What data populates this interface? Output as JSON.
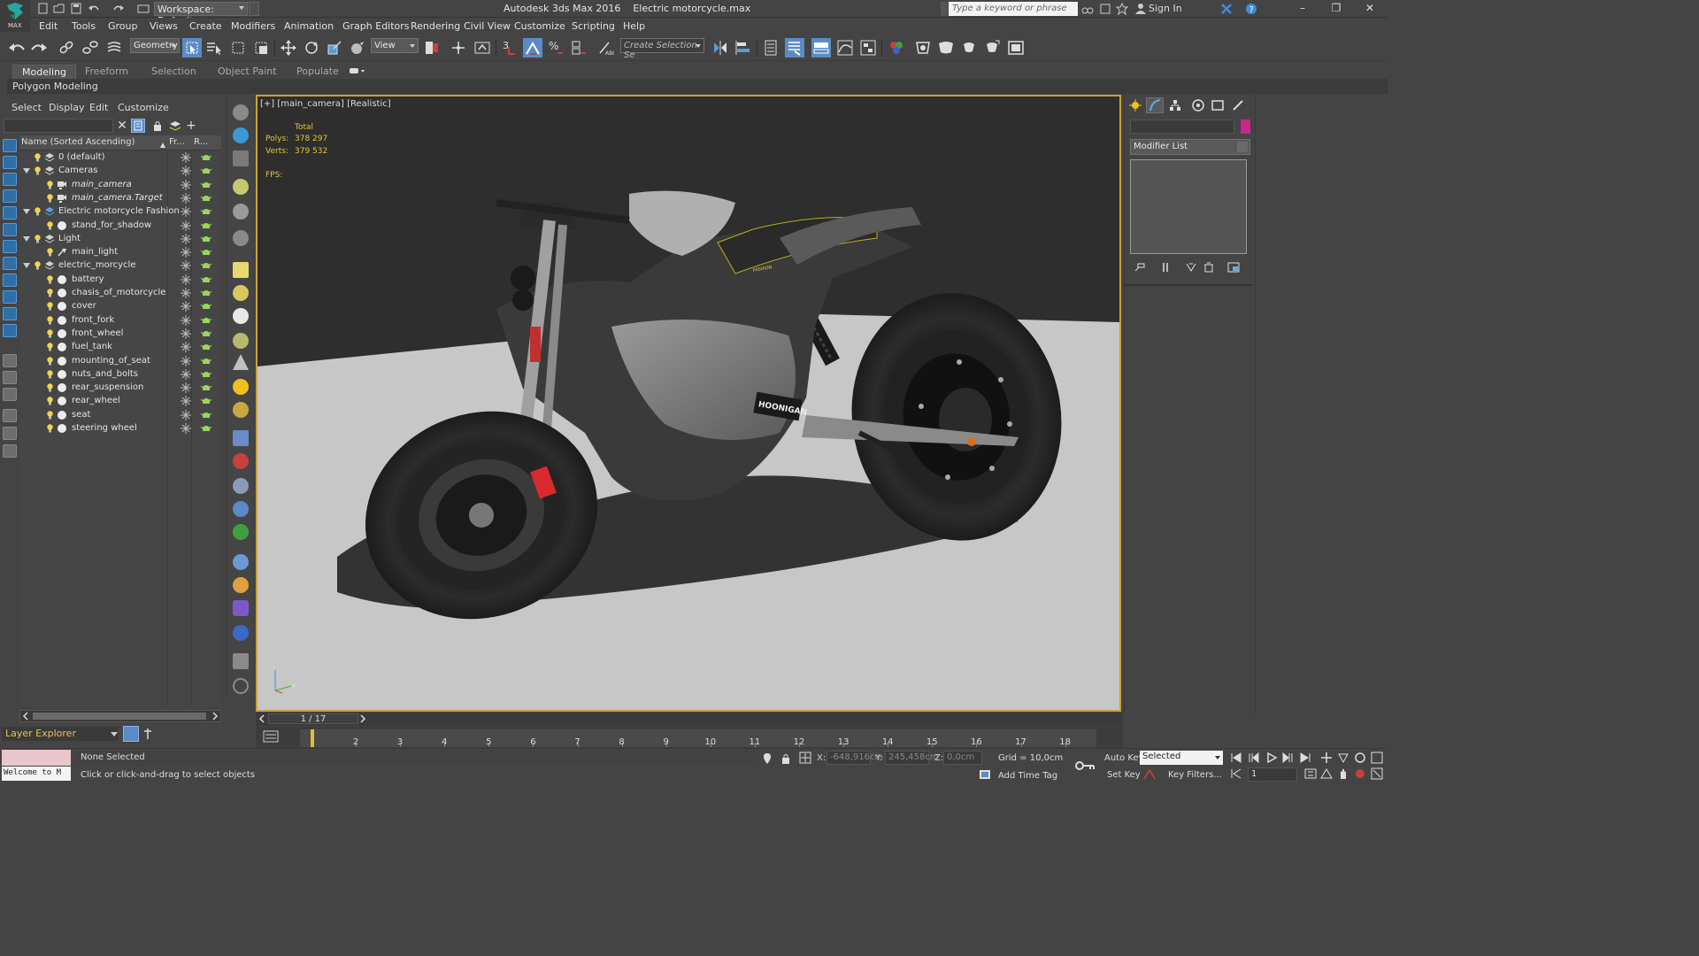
{
  "app": {
    "title": "Autodesk 3ds Max 2016    Electric motorcycle.max",
    "workspace": "Workspace: Default",
    "logo_text": "MAX",
    "search_placeholder": "Type a keyword or phrase",
    "sign_in": "Sign In",
    "window_controls": [
      "–",
      "❐",
      "✕"
    ]
  },
  "menubar": [
    "Edit",
    "Tools",
    "Group",
    "Views",
    "Create",
    "Modifiers",
    "Animation",
    "Graph Editors",
    "Rendering",
    "Civil View",
    "Customize",
    "Scripting",
    "Help"
  ],
  "toolbar": {
    "selection_filter": "Geometry",
    "ref_coord": "View",
    "snap_labels": [
      "3",
      "%",
      "n"
    ],
    "named_selection": "Create Selection Se"
  },
  "ribbon": {
    "tabs": [
      "Modeling",
      "Freeform",
      "Selection",
      "Object Paint",
      "Populate"
    ],
    "active_tab": "Modeling",
    "panel_label": "Polygon Modeling"
  },
  "explorer": {
    "menu": [
      "Select",
      "Display",
      "Edit",
      "Customize"
    ],
    "columns": {
      "name": "Name (Sorted Ascending)",
      "frozen": "Fr...",
      "render": "R..."
    },
    "rows": [
      {
        "label": "0 (default)",
        "indent": 0,
        "type": "layer",
        "expander": false,
        "italic": false
      },
      {
        "label": "Cameras",
        "indent": 0,
        "type": "layer",
        "expander": true,
        "italic": false
      },
      {
        "label": "main_camera",
        "indent": 1,
        "type": "camera",
        "expander": false,
        "italic": true
      },
      {
        "label": "main_camera.Target",
        "indent": 1,
        "type": "camera",
        "expander": false,
        "italic": true
      },
      {
        "label": "Electric motorcycle Fashion",
        "indent": 0,
        "type": "layer-blue",
        "expander": true,
        "italic": false
      },
      {
        "label": "stand_for_shadow",
        "indent": 1,
        "type": "geo",
        "expander": false,
        "italic": false
      },
      {
        "label": "Light",
        "indent": 0,
        "type": "layer",
        "expander": true,
        "italic": false
      },
      {
        "label": "main_light",
        "indent": 1,
        "type": "light",
        "expander": false,
        "italic": false
      },
      {
        "label": "electric_morcycle",
        "indent": 0,
        "type": "layer",
        "expander": true,
        "italic": false
      },
      {
        "label": "battery",
        "indent": 1,
        "type": "geo",
        "expander": false,
        "italic": false
      },
      {
        "label": "chasis_of_motorcycle",
        "indent": 1,
        "type": "geo",
        "expander": false,
        "italic": false
      },
      {
        "label": "cover",
        "indent": 1,
        "type": "geo",
        "expander": false,
        "italic": false
      },
      {
        "label": "front_fork",
        "indent": 1,
        "type": "geo",
        "expander": false,
        "italic": false
      },
      {
        "label": "front_wheel",
        "indent": 1,
        "type": "geo",
        "expander": false,
        "italic": false
      },
      {
        "label": "fuel_tank",
        "indent": 1,
        "type": "geo",
        "expander": false,
        "italic": false
      },
      {
        "label": "mounting_of_seat",
        "indent": 1,
        "type": "geo",
        "expander": false,
        "italic": false
      },
      {
        "label": "nuts_and_bolts",
        "indent": 1,
        "type": "geo",
        "expander": false,
        "italic": false
      },
      {
        "label": "rear_suspension",
        "indent": 1,
        "type": "geo",
        "expander": false,
        "italic": false
      },
      {
        "label": "rear_wheel",
        "indent": 1,
        "type": "geo",
        "expander": false,
        "italic": false
      },
      {
        "label": "seat",
        "indent": 1,
        "type": "geo",
        "expander": false,
        "italic": false
      },
      {
        "label": "steering wheel",
        "indent": 1,
        "type": "geo",
        "expander": false,
        "italic": false
      }
    ],
    "layer_explorer_label": "Layer Explorer"
  },
  "viewport": {
    "label": "[+] [main_camera] [Realistic]",
    "stats": {
      "total_label": "Total",
      "polys_label": "Polys:",
      "polys": "378 297",
      "verts_label": "Verts:",
      "verts": "379 532",
      "fps_label": "FPS:"
    },
    "decal_text": "HOONIGAN",
    "seat_text": "FASHION",
    "axis_labels": {
      "z": "z",
      "y": "y",
      "x": "x"
    },
    "colors": {
      "background": "#2e2e2e",
      "floor": "#c7c7c7",
      "border": "#c8a23a",
      "caliper": "#d8292c"
    }
  },
  "command_panel": {
    "modifier_list": "Modifier List",
    "object_color": "#c8288c"
  },
  "timeline": {
    "slider_text": "1 / 17",
    "ticks": [
      "2",
      "3",
      "4",
      "5",
      "6",
      "7",
      "8",
      "9",
      "10",
      "11",
      "12",
      "13",
      "14",
      "15",
      "16",
      "17",
      "18"
    ]
  },
  "status": {
    "welcome": "Welcome to M",
    "selection": "None Selected",
    "prompt": "Click or click-and-drag to select objects",
    "x_label": "X:",
    "x": "-648,916cm",
    "y_label": "Y:",
    "y": "245,458cm",
    "z_label": "Z:",
    "z": "0,0cm",
    "grid": "Grid = 10,0cm",
    "add_time_tag": "Add Time Tag",
    "auto_key": "Auto Key",
    "set_key": "Set Key",
    "key_mode": "Selected",
    "key_filters": "Key Filters...",
    "current_frame": "1"
  }
}
